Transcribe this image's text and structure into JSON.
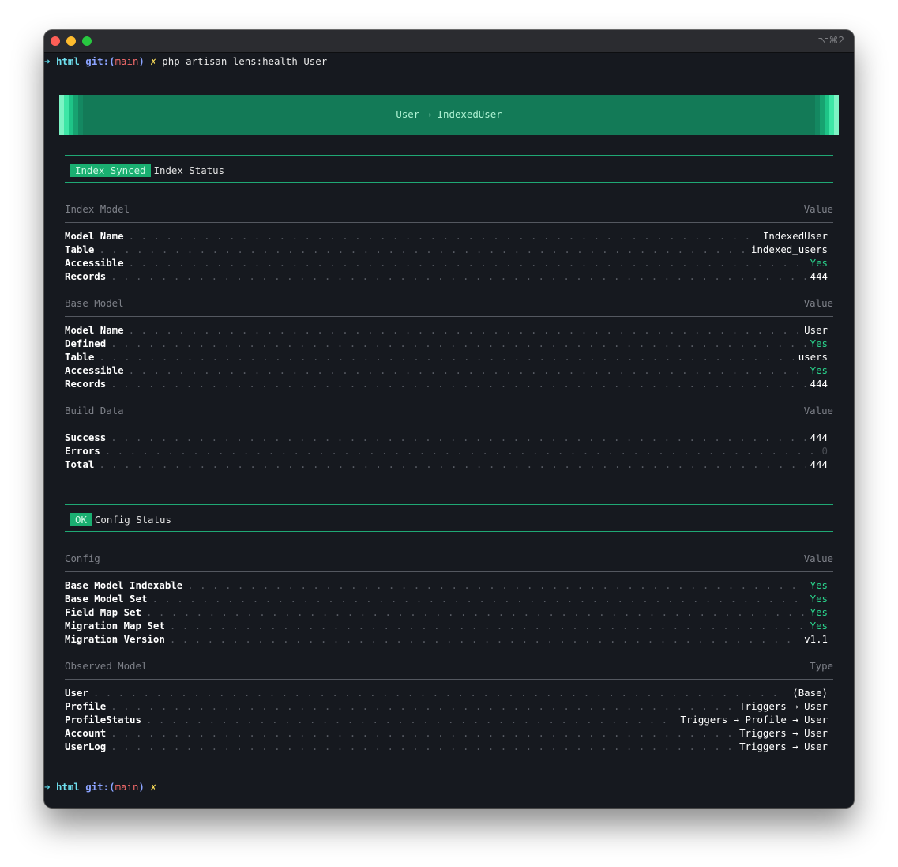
{
  "window": {
    "shortcut": "⌥⌘2"
  },
  "prompt": {
    "arrow": "➜",
    "dir": "html",
    "git_label": "git:(",
    "branch": "main",
    "git_close": ")",
    "dirty": "✗",
    "command": "php artisan lens:health User"
  },
  "banner": {
    "title": "User → IndexedUser"
  },
  "index_status": {
    "badge": "Index Synced",
    "label": "Index Status"
  },
  "index_model": {
    "header": "Index Model",
    "value_header": "Value",
    "rows": [
      {
        "key": "Model Name",
        "value": "IndexedUser"
      },
      {
        "key": "Table",
        "value": "indexed_users"
      },
      {
        "key": "Accessible",
        "value": "Yes"
      },
      {
        "key": "Records",
        "value": "444"
      }
    ]
  },
  "base_model": {
    "header": "Base Model",
    "value_header": "Value",
    "rows": [
      {
        "key": "Model Name",
        "value": "User"
      },
      {
        "key": "Defined",
        "value": "Yes"
      },
      {
        "key": "Table",
        "value": "users"
      },
      {
        "key": "Accessible",
        "value": "Yes"
      },
      {
        "key": "Records",
        "value": "444"
      }
    ]
  },
  "build_data": {
    "header": "Build Data",
    "value_header": "Value",
    "rows": [
      {
        "key": "Success",
        "value": "444"
      },
      {
        "key": "Errors",
        "value": "0"
      },
      {
        "key": "Total",
        "value": "444"
      }
    ]
  },
  "config_status": {
    "badge": "OK",
    "label": "Config Status"
  },
  "config": {
    "header": "Config",
    "value_header": "Value",
    "rows": [
      {
        "key": "Base Model Indexable",
        "value": "Yes"
      },
      {
        "key": "Base Model Set",
        "value": "Yes"
      },
      {
        "key": "Field Map Set",
        "value": "Yes"
      },
      {
        "key": "Migration Map Set",
        "value": "Yes"
      },
      {
        "key": "Migration Version",
        "value": "v1.1"
      }
    ]
  },
  "observed": {
    "header": "Observed Model",
    "value_header": "Type",
    "rows": [
      {
        "key": "User",
        "value": "(Base)"
      },
      {
        "key": "Profile",
        "value": "Triggers → User"
      },
      {
        "key": "ProfileStatus",
        "value": "Triggers → Profile → User"
      },
      {
        "key": "Account",
        "value": "Triggers → User"
      },
      {
        "key": "UserLog",
        "value": "Triggers → User"
      }
    ]
  },
  "colors": {
    "accent": "#1aaf71",
    "yes": "#2ad58d",
    "banner": "#137a57"
  }
}
